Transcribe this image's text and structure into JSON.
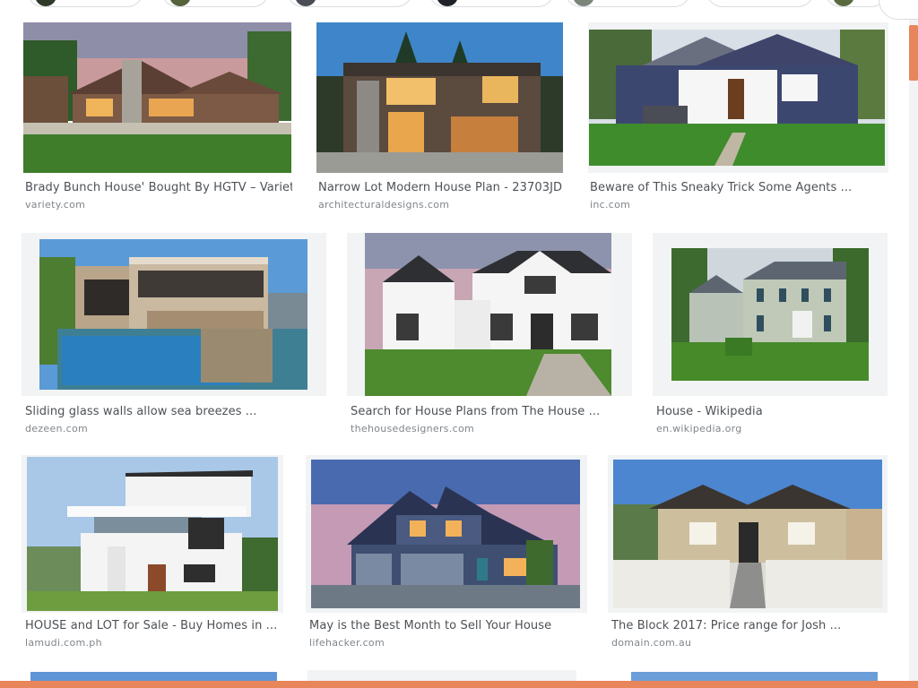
{
  "chips": [
    {
      "icon": "house-thumb",
      "color": "#2f3a2a"
    },
    {
      "icon": "house-thumb",
      "color": "#56623a"
    },
    {
      "icon": "house-thumb",
      "color": "#4a4d55"
    },
    {
      "icon": "house-thumb",
      "color": "#1f2228"
    },
    {
      "icon": "house-thumb",
      "color": "#7b857a"
    },
    {
      "icon": "house-thumb",
      "color": "#9a9a9a"
    },
    {
      "icon": "house-thumb",
      "color": "#5a6a3f"
    }
  ],
  "results": [
    {
      "title": "Brady Bunch House' Bought By HGTV – Variety",
      "source": "variety.com"
    },
    {
      "title": "Narrow Lot Modern House Plan - 23703JD ...",
      "source": "architecturaldesigns.com"
    },
    {
      "title": "Beware of This Sneaky Trick Some Agents ...",
      "source": "inc.com"
    },
    {
      "title": "Sliding glass walls allow sea breezes ...",
      "source": "dezeen.com"
    },
    {
      "title": "Search for House Plans from The House ...",
      "source": "thehousedesigners.com"
    },
    {
      "title": "House - Wikipedia",
      "source": "en.wikipedia.org"
    },
    {
      "title": "HOUSE and LOT for Sale - Buy Homes in ...",
      "source": "lamudi.com.ph"
    },
    {
      "title": "May is the Best Month to Sell Your House",
      "source": "lifehacker.com"
    },
    {
      "title": "The Block 2017: Price range for Josh ...",
      "source": "domain.com.au"
    }
  ],
  "colors": {
    "accent": "#e8855a",
    "title_text": "#4d5156",
    "source_text": "#80868b",
    "frame": "#f1f3f4"
  }
}
